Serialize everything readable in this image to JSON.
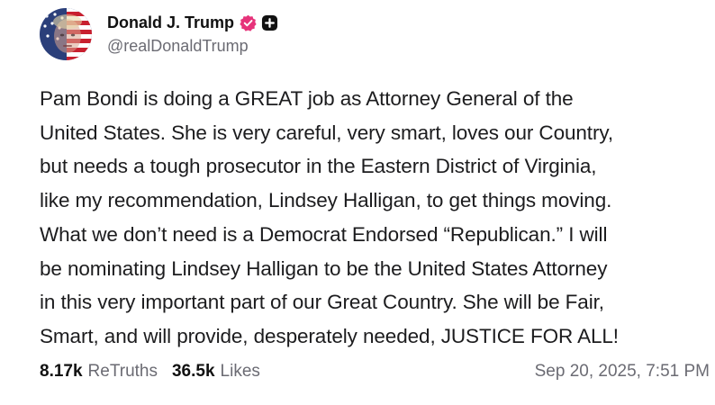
{
  "author": {
    "display_name": "Donald J. Trump",
    "handle": "@realDonaldTrump",
    "verified_badge_color": "#e6337a",
    "icons": [
      "avatar",
      "verified-badge-icon",
      "plus-badge-icon"
    ]
  },
  "post": {
    "text": "Pam Bondi is doing a GREAT job as Attorney General of the\nUnited States. She is very careful, very smart, loves our Country,\nbut needs a tough prosecutor in the Eastern District of Virginia,\nlike my recommendation, Lindsey Halligan, to get things moving.\nWhat we don’t need is a Democrat Endorsed “Republican.” I will\nbe nominating Lindsey Halligan to be the United States Attorney\nin this very important part of our Great Country. She will be Fair,\nSmart, and will provide, desperately needed, JUSTICE FOR ALL!"
  },
  "stats": {
    "retruths_count": "8.17k",
    "retruths_label": "ReTruths",
    "likes_count": "36.5k",
    "likes_label": "Likes",
    "timestamp": "Sep 20, 2025, 7:51 PM"
  }
}
